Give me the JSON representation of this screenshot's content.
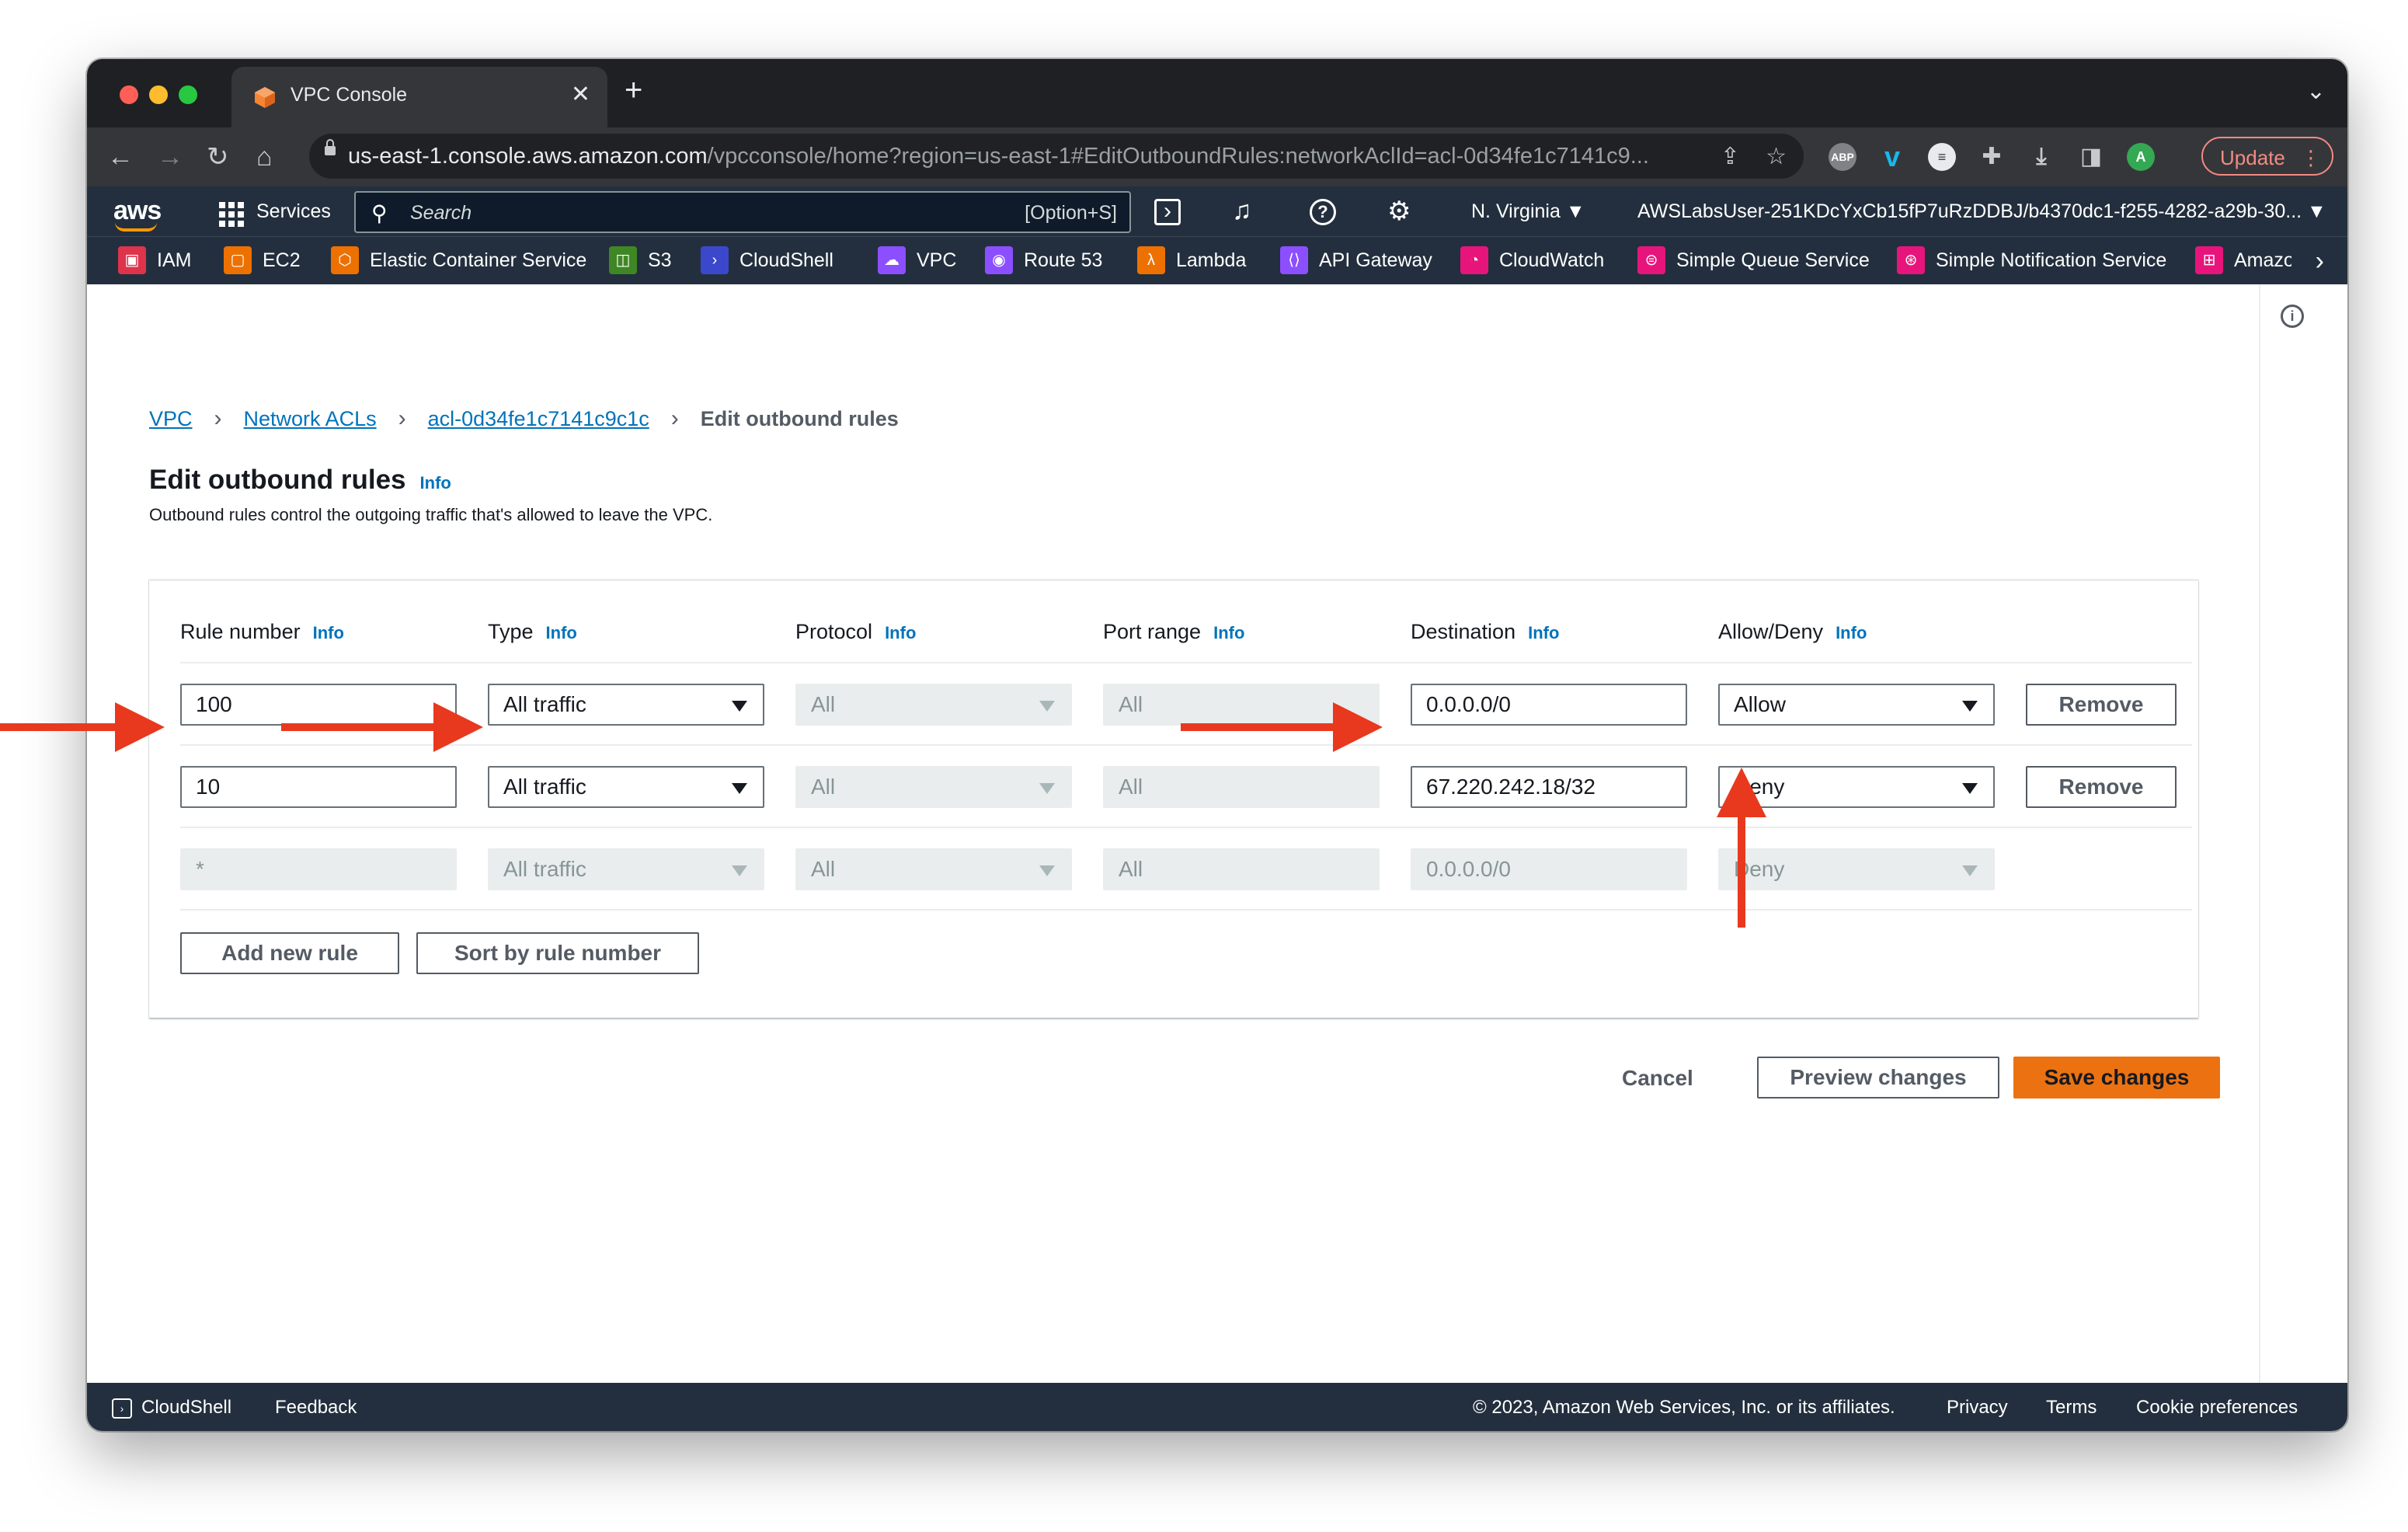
{
  "browser": {
    "tab_title": "VPC Console",
    "url_host": "us-east-1.console.aws.amazon.com",
    "url_path": "/vpcconsole/home?region=us-east-1#EditOutboundRules:networkAclId=acl-0d34fe1c7141c9...",
    "profile_initial": "A",
    "update_label": "Update"
  },
  "aws_nav": {
    "logo": "aws",
    "services_label": "Services",
    "search_placeholder": "Search",
    "search_shortcut": "[Option+S]",
    "region": "N. Virginia ▼",
    "account": "AWSLabsUser-251KDcYxCb15fP7uRzDDBJ/b4370dc1-f255-4282-a29b-30... ▼"
  },
  "favorites": [
    {
      "label": "IAM",
      "color": "#dd344c",
      "icon": "iam-icon"
    },
    {
      "label": "EC2",
      "color": "#ed7100",
      "icon": "ec2-icon"
    },
    {
      "label": "Elastic Container Service",
      "color": "#ed7100",
      "icon": "ecs-icon"
    },
    {
      "label": "S3",
      "color": "#3f8624",
      "icon": "s3-icon"
    },
    {
      "label": "CloudShell",
      "color": "#3b48cc",
      "icon": "cloudshell-icon"
    },
    {
      "label": "VPC",
      "color": "#8c4fff",
      "icon": "vpc-icon"
    },
    {
      "label": "Route 53",
      "color": "#8c4fff",
      "icon": "route53-icon"
    },
    {
      "label": "Lambda",
      "color": "#ed7100",
      "icon": "lambda-icon"
    },
    {
      "label": "API Gateway",
      "color": "#8c4fff",
      "icon": "api-gateway-icon"
    },
    {
      "label": "CloudWatch",
      "color": "#e7157b",
      "icon": "cloudwatch-icon"
    },
    {
      "label": "Simple Queue Service",
      "color": "#e7157b",
      "icon": "sqs-icon"
    },
    {
      "label": "Simple Notification Service",
      "color": "#e7157b",
      "icon": "sns-icon"
    },
    {
      "label": "Amazo",
      "color": "#e7157b",
      "icon": "service-icon"
    }
  ],
  "breadcrumbs": {
    "vpc": "VPC",
    "nacls": "Network ACLs",
    "acl": "acl-0d34fe1c7141c9c1c",
    "current": "Edit outbound rules"
  },
  "page": {
    "title": "Edit outbound rules",
    "info": "Info",
    "description": "Outbound rules control the outgoing traffic that's allowed to leave the VPC."
  },
  "table": {
    "headers": {
      "rule_number": "Rule number",
      "type": "Type",
      "protocol": "Protocol",
      "port_range": "Port range",
      "destination": "Destination",
      "allow_deny": "Allow/Deny"
    },
    "rows": [
      {
        "rule": "100",
        "type": "All traffic",
        "protocol": "All",
        "port": "All",
        "destination": "0.0.0.0/0",
        "action": "Allow",
        "remove": "Remove"
      },
      {
        "rule": "10",
        "type": "All traffic",
        "protocol": "All",
        "port": "All",
        "destination": "67.220.242.18/32",
        "action": "Deny",
        "remove": "Remove"
      },
      {
        "rule": "*",
        "type": "All traffic",
        "protocol": "All",
        "port": "All",
        "destination": "0.0.0.0/0",
        "action": "Deny"
      }
    ],
    "add_rule": "Add new rule",
    "sort_rules": "Sort by rule number"
  },
  "actions": {
    "cancel": "Cancel",
    "preview": "Preview changes",
    "save": "Save changes"
  },
  "footer": {
    "cloudshell": "CloudShell",
    "feedback": "Feedback",
    "copyright": "© 2023, Amazon Web Services, Inc. or its affiliates.",
    "privacy": "Privacy",
    "terms": "Terms",
    "cookies": "Cookie preferences"
  },
  "colors": {
    "accent_orange": "#ec7211",
    "link_blue": "#0073bb",
    "annotation_red": "#e8391e",
    "aws_nav": "#232f3e"
  }
}
